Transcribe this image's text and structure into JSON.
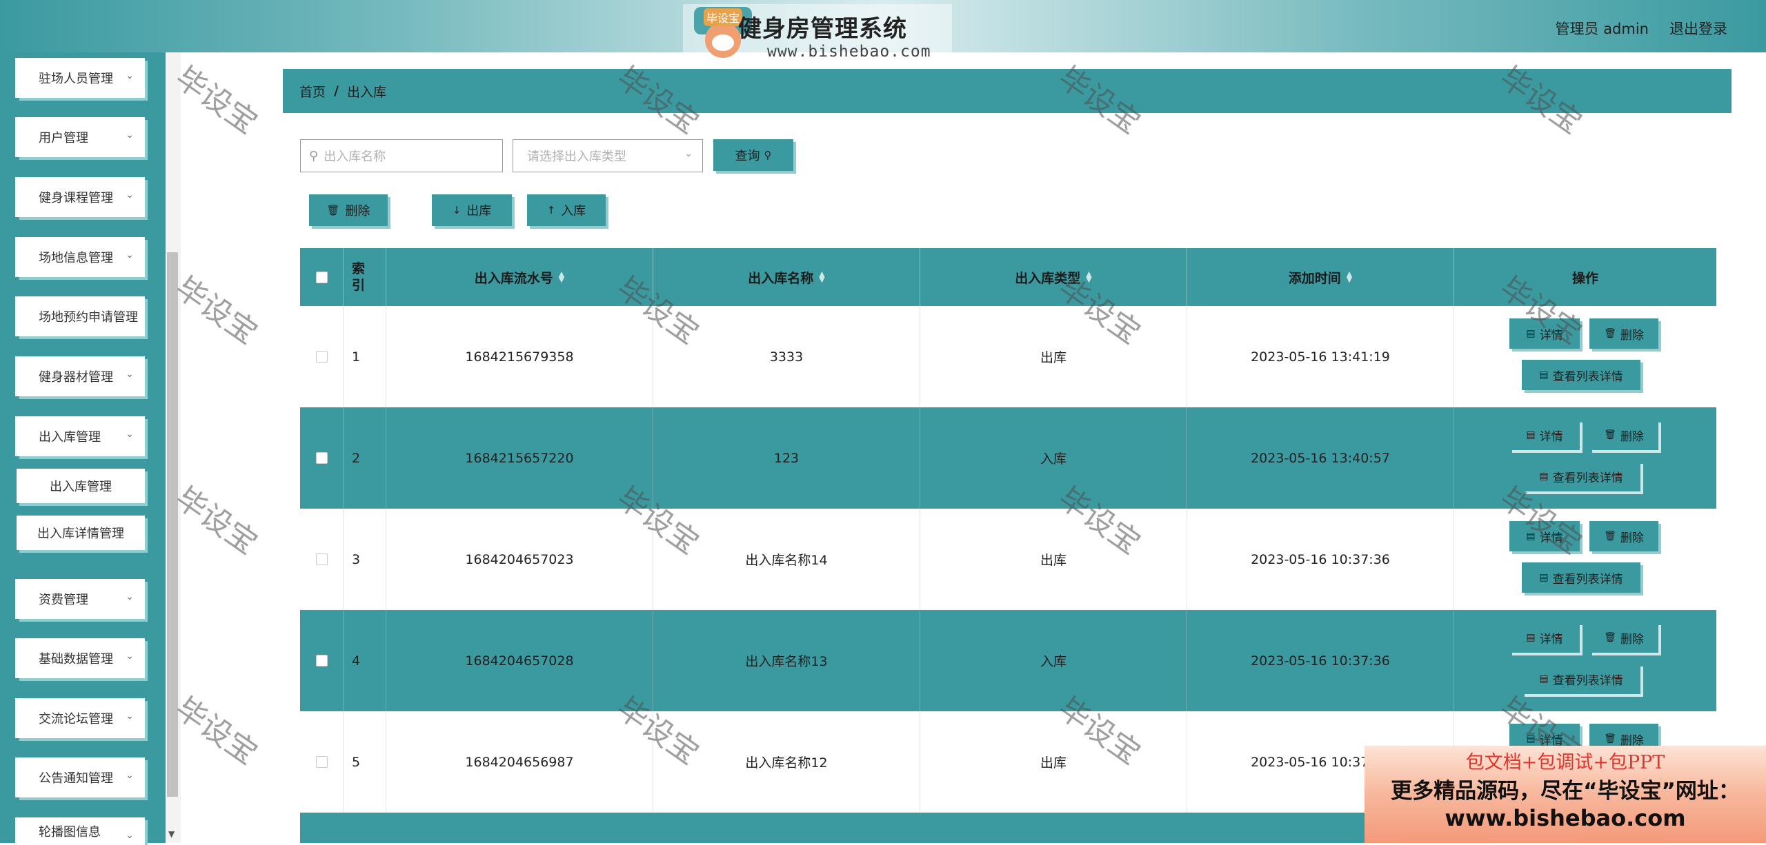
{
  "header": {
    "title": "健身房管理系统",
    "brand_badge": "毕设宝",
    "brand_url": "www.bishebao.com",
    "user_label": "管理员 admin",
    "logout_label": "退出登录"
  },
  "sidebar": {
    "items": [
      {
        "label": "驻场人员管理"
      },
      {
        "label": "用户管理"
      },
      {
        "label": "健身课程管理"
      },
      {
        "label": "场地信息管理"
      },
      {
        "label": "场地预约申请管理"
      },
      {
        "label": "健身器材管理"
      },
      {
        "label": "出入库管理"
      },
      {
        "label": "资费管理"
      },
      {
        "label": "基础数据管理"
      },
      {
        "label": "交流论坛管理"
      },
      {
        "label": "公告通知管理"
      },
      {
        "label": "轮播图信息"
      }
    ],
    "subitems": [
      {
        "label": "出入库管理"
      },
      {
        "label": "出入库详情管理"
      }
    ]
  },
  "breadcrumb": {
    "home": "首页",
    "separator": "/",
    "current": "出入库"
  },
  "search": {
    "name_placeholder": "出入库名称",
    "type_placeholder": "请选择出入库类型",
    "query_label": "查询"
  },
  "toolbar": {
    "delete_label": "删除",
    "out_label": "出库",
    "in_label": "入库"
  },
  "table": {
    "headers": {
      "index": "索引",
      "serial_no": "出入库流水号",
      "name": "出入库名称",
      "type": "出入库类型",
      "time": "添加时间",
      "ops": "操作"
    },
    "op_labels": {
      "detail": "详情",
      "delete": "删除",
      "list_detail": "查看列表详情"
    },
    "rows": [
      {
        "index": "1",
        "serial_no": "1684215679358",
        "name": "3333",
        "type": "出库",
        "time": "2023-05-16 13:41:19"
      },
      {
        "index": "2",
        "serial_no": "1684215657220",
        "name": "123",
        "type": "入库",
        "time": "2023-05-16 13:40:57"
      },
      {
        "index": "3",
        "serial_no": "1684204657023",
        "name": "出入库名称14",
        "type": "出库",
        "time": "2023-05-16 10:37:36"
      },
      {
        "index": "4",
        "serial_no": "1684204657028",
        "name": "出入库名称13",
        "type": "入库",
        "time": "2023-05-16 10:37:36"
      },
      {
        "index": "5",
        "serial_no": "1684204656987",
        "name": "出入库名称12",
        "type": "出库",
        "time": "2023-05-16 10:37:36"
      }
    ]
  },
  "watermark": "毕设宝",
  "ad": {
    "line1": "包文档+包调试+包PPT",
    "line2": "更多精品源码，尽在“毕设宝”网址：",
    "line3": "www.bishebao.com"
  },
  "colors": {
    "primary": "#3a9aa0",
    "shadow": "#8fcdd1",
    "ad_red": "#e0342c"
  }
}
